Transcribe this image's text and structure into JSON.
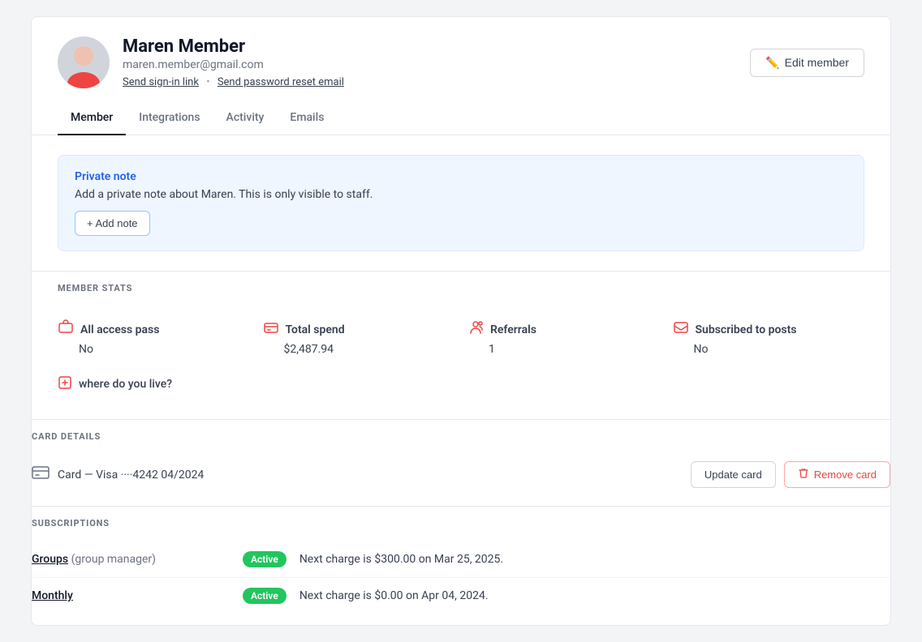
{
  "header": {
    "name": "Maren Member",
    "email": "maren.member@gmail.com",
    "sign_in_link": "Send sign-in link",
    "password_reset_link": "Send password reset email",
    "edit_button_label": "Edit member"
  },
  "tabs": [
    {
      "id": "member",
      "label": "Member",
      "active": true
    },
    {
      "id": "integrations",
      "label": "Integrations",
      "active": false
    },
    {
      "id": "activity",
      "label": "Activity",
      "active": false
    },
    {
      "id": "emails",
      "label": "Emails",
      "active": false
    }
  ],
  "private_note": {
    "title": "Private note",
    "description": "Add a private note about Maren. This is only visible to staff.",
    "add_button_label": "+ Add note"
  },
  "member_stats": {
    "section_label": "MEMBER STATS",
    "stats": [
      {
        "id": "all_access_pass",
        "title": "All access pass",
        "value": "No"
      },
      {
        "id": "total_spend",
        "title": "Total spend",
        "value": "$2,487.94"
      },
      {
        "id": "referrals",
        "title": "Referrals",
        "value": "1"
      },
      {
        "id": "subscribed_to_posts",
        "title": "Subscribed to posts",
        "value": "No"
      }
    ],
    "custom_field": {
      "label": "where do you live?"
    }
  },
  "card_details": {
    "section_label": "CARD DETAILS",
    "card_text": "Card — Visa ····4242   04/2024",
    "update_button": "Update card",
    "remove_button": "Remove card"
  },
  "subscriptions": {
    "section_label": "SUBSCRIPTIONS",
    "items": [
      {
        "name": "Groups",
        "name_suffix": "(group manager)",
        "status": "Active",
        "next_charge": "Next charge is $300.00 on  Mar 25, 2025."
      },
      {
        "name": "Monthly",
        "name_suffix": "",
        "status": "Active",
        "next_charge": "Next charge is $0.00 on  Apr 04, 2024."
      }
    ]
  }
}
